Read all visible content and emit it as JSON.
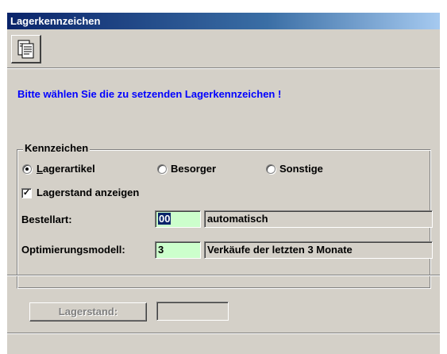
{
  "window": {
    "title": "Lagerkennzeichen"
  },
  "toolbar": {
    "document_icon": "document-icon"
  },
  "prompt": "Bitte wählen Sie die zu setzenden Lagerkennzeichen !",
  "kennzeichen": {
    "legend": "Kennzeichen",
    "radios": [
      {
        "label": "Lagerartikel",
        "selected": true
      },
      {
        "label": "Besorger",
        "selected": false
      },
      {
        "label": "Sonstige",
        "selected": false
      }
    ],
    "checkbox": {
      "label": "Lagerstand anzeigen",
      "checked": true
    },
    "bestellart": {
      "label": "Bestellart:",
      "code": "00",
      "description": "automatisch"
    },
    "optimierung": {
      "label": "Optimierungsmodell:",
      "code": "3",
      "description": "Verkäufe der letzten 3 Monate"
    }
  },
  "lagerstand": {
    "button_label": "Lagerstand:",
    "value": ""
  },
  "colors": {
    "prompt": "#0000ff",
    "field_green": "#ccffcc",
    "title_bar": "#0a246a"
  }
}
